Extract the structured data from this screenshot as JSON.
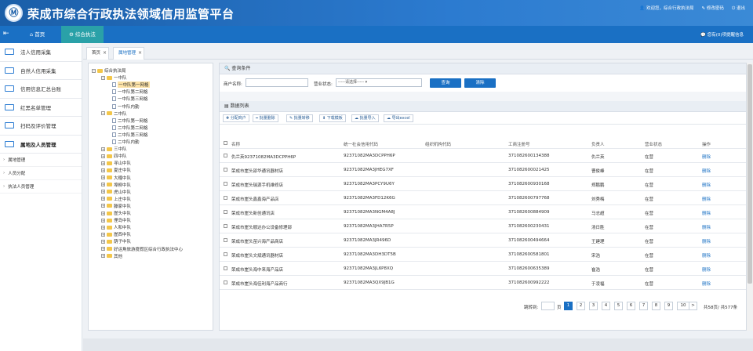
{
  "header": {
    "logo": "Ⓜ",
    "title": "荣成市综合行政执法领域信用监管平台",
    "user": "欢迎您，综合行政执法局",
    "change_password": "修改密码",
    "logout": "退出"
  },
  "nav": {
    "home": "首页",
    "active": "综合执法",
    "messages": "您有(0)项提醒信息"
  },
  "sidebar": {
    "menus": [
      "法人信用采集",
      "自然人信用采集",
      "信用信息汇总台账",
      "红黑名单管理",
      "扫码及评价管理",
      "属地及人员管理"
    ],
    "subs": [
      "属地管理",
      "人员分配",
      "执法人员管理"
    ]
  },
  "tabs": [
    "首页",
    "属地管理"
  ],
  "tree": [
    {
      "label": "综合执法局",
      "kind": "folder",
      "pm": "−"
    },
    {
      "label": "一中队",
      "kind": "folder",
      "pm": "−"
    },
    {
      "label": "一中队第一网格",
      "kind": "doc",
      "hl": true
    },
    {
      "label": "一中队第二网格",
      "kind": "doc"
    },
    {
      "label": "一中队第三网格",
      "kind": "doc"
    },
    {
      "label": "一中队内勤",
      "kind": "doc"
    },
    {
      "label": "二中队",
      "kind": "folder",
      "pm": "−"
    },
    {
      "label": "二中队第一网格",
      "kind": "doc"
    },
    {
      "label": "二中队第二网格",
      "kind": "doc"
    },
    {
      "label": "二中队第三网格",
      "kind": "doc"
    },
    {
      "label": "二中队内勤",
      "kind": "doc"
    },
    {
      "label": "三中队",
      "kind": "folder",
      "pm": "+"
    },
    {
      "label": "四中队",
      "kind": "folder",
      "pm": "+"
    },
    {
      "label": "寻山中队",
      "kind": "folder",
      "pm": "+"
    },
    {
      "label": "夏庄中队",
      "kind": "folder",
      "pm": "+"
    },
    {
      "label": "大疃中队",
      "kind": "folder",
      "pm": "+"
    },
    {
      "label": "埠柳中队",
      "kind": "folder",
      "pm": "+"
    },
    {
      "label": "虎山中队",
      "kind": "folder",
      "pm": "+"
    },
    {
      "label": "上庄中队",
      "kind": "folder",
      "pm": "+"
    },
    {
      "label": "滕家中队",
      "kind": "folder",
      "pm": "+"
    },
    {
      "label": "崖头中队",
      "kind": "folder",
      "pm": "+"
    },
    {
      "label": "俚岛中队",
      "kind": "folder",
      "pm": "+"
    },
    {
      "label": "人和中队",
      "kind": "folder",
      "pm": "+"
    },
    {
      "label": "崖西中队",
      "kind": "folder",
      "pm": "+"
    },
    {
      "label": "荫子中队",
      "kind": "folder",
      "pm": "+"
    },
    {
      "label": "好运角旅游度假区综合行政执法中心",
      "kind": "folder",
      "pm": "+"
    },
    {
      "label": "其他",
      "kind": "folder",
      "pm": "+"
    }
  ],
  "query": {
    "title": "查询条件",
    "name_label": "商户名称:",
    "status_label": "营业状态:",
    "status_value": "-----请选择-----",
    "search": "查询",
    "clear": "清除"
  },
  "list": {
    "title": "数据列表",
    "buttons": [
      "分配商户",
      "批量删除",
      "批量转移",
      "下载模板",
      "批量导入",
      "导出excel"
    ],
    "headers": [
      "名称",
      "统一社会信用代码",
      "组织机构代码",
      "工商注册号",
      "负责人",
      "营业状态",
      "操作"
    ],
    "rows": [
      [
        "仇兰英92371082MA3DCPPH6P",
        "92371082MA3DCPPH6P",
        "",
        "371082600134388",
        "仇兰英",
        "在营",
        "删除"
      ],
      [
        "荣成市崖头邵华通讯器材店",
        "92371082MA3JHEG7XF",
        "",
        "371082600021425",
        "曹俊峰",
        "在营",
        "删除"
      ],
      [
        "荣成市崖头瑞源手机维修店",
        "92371082MA3PCY9U6Y",
        "",
        "371082600930168",
        "郑鹏鹏",
        "在营",
        "删除"
      ],
      [
        "荣成市崖头鑫鑫海产品店",
        "92371082MA3FD12K6G",
        "",
        "371082600797768",
        "刘秀梅",
        "在营",
        "删除"
      ],
      [
        "荣成市崖头新创通讯店",
        "92371082MA3NGM4A8J",
        "",
        "371082600884909",
        "马志超",
        "在营",
        "删除"
      ],
      [
        "荣成市崖头顺达办公设备修理部",
        "92371082MA3JHA7R5P",
        "",
        "371082600230431",
        "汤日胜",
        "在营",
        "删除"
      ],
      [
        "荣成市崖头苗兴海产品商店",
        "92371082MA3JR496D",
        "",
        "371082600494664",
        "王建理",
        "在营",
        "删除"
      ],
      [
        "荣成市崖头文斌通讯器材店",
        "92371082MA3DH3DT5B",
        "",
        "371082600581801",
        "宋浩",
        "在营",
        "删除"
      ],
      [
        "荣成市崖头海中来海产品店",
        "92371082MA3JL6P8XQ",
        "",
        "371082600635389",
        "崔浩",
        "在营",
        "删除"
      ],
      [
        "荣成市崖头海佳利海产品商行",
        "92371082MA3QX9JB1G",
        "",
        "371082600992222",
        "于凌福",
        "在营",
        "删除"
      ]
    ]
  },
  "pager": {
    "goto": "跳转到:",
    "page_unit": "页",
    "pages": [
      "1",
      "2",
      "3",
      "4",
      "5",
      "6",
      "7",
      "8",
      "9",
      "10"
    ],
    "next": ">",
    "summary": "共58页/ 共577条"
  }
}
